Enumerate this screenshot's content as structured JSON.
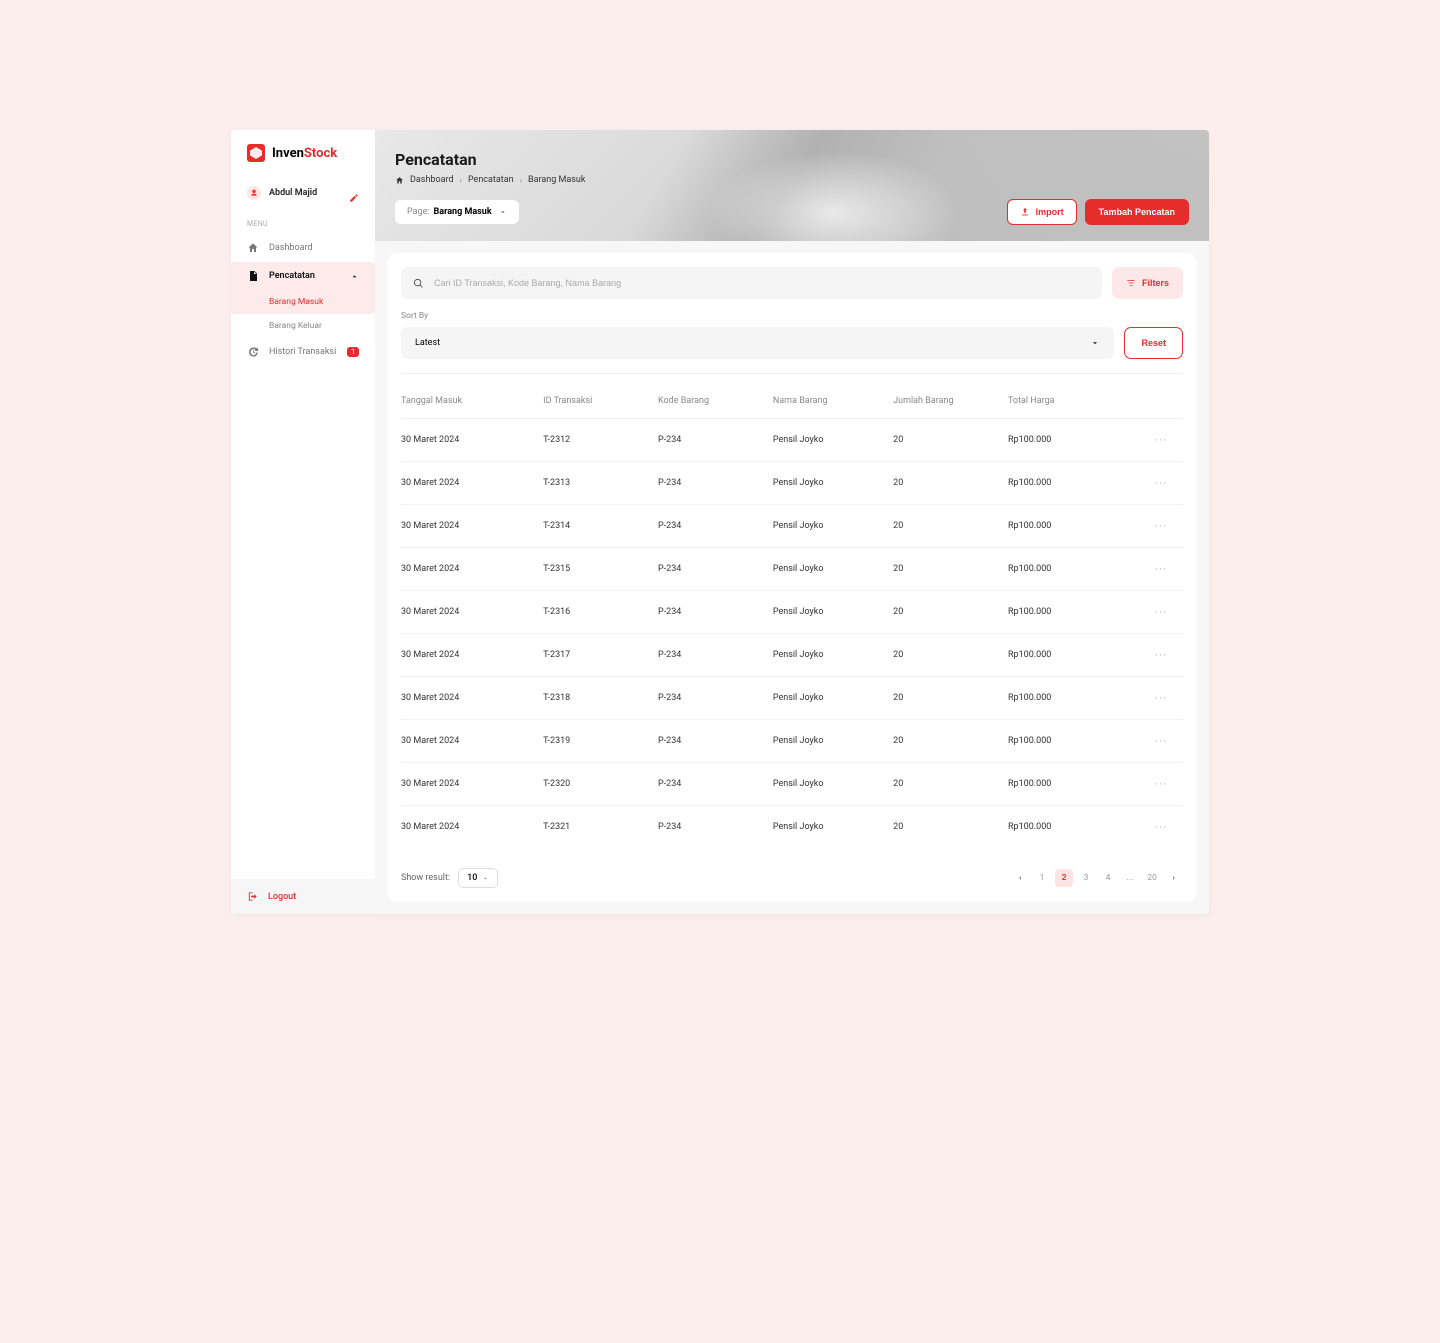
{
  "brand": {
    "name1": "Inven",
    "name2": "Stock"
  },
  "user": {
    "name": "Abdul Majid"
  },
  "menu": {
    "label": "MENU",
    "items": {
      "dashboard": "Dashboard",
      "pencatatan": "Pencatatan",
      "barang_masuk": "Barang Masuk",
      "barang_keluar": "Barang Keluar",
      "histori": "Histori Transaksi",
      "histori_badge": "1"
    }
  },
  "logout": "Logout",
  "header": {
    "title": "Pencatatan",
    "crumbs": [
      "Dashboard",
      "Pencatatan",
      "Barang Masuk"
    ],
    "page_label": "Page: ",
    "page_value": "Barang Masuk",
    "import": "Import",
    "add": "Tambah Pencatan"
  },
  "search": {
    "placeholder": "Cari ID Transaksi, Kode Barang, Nama Barang"
  },
  "filters_btn": "Filters",
  "sort": {
    "label": "Sort By",
    "value": "Latest",
    "reset": "Reset"
  },
  "columns": [
    "Tanggal Masuk",
    "ID Transaksi",
    "Kode Barang",
    "Nama Barang",
    "Jumlah Barang",
    "Total Harga"
  ],
  "rows": [
    {
      "tgl": "30 Maret 2024",
      "id": "T-2312",
      "kode": "P-234",
      "nama": "Pensil Joyko",
      "jml": "20",
      "total": "Rp100.000"
    },
    {
      "tgl": "30 Maret 2024",
      "id": "T-2313",
      "kode": "P-234",
      "nama": "Pensil Joyko",
      "jml": "20",
      "total": "Rp100.000"
    },
    {
      "tgl": "30 Maret 2024",
      "id": "T-2314",
      "kode": "P-234",
      "nama": "Pensil Joyko",
      "jml": "20",
      "total": "Rp100.000"
    },
    {
      "tgl": "30 Maret 2024",
      "id": "T-2315",
      "kode": "P-234",
      "nama": "Pensil Joyko",
      "jml": "20",
      "total": "Rp100.000"
    },
    {
      "tgl": "30 Maret 2024",
      "id": "T-2316",
      "kode": "P-234",
      "nama": "Pensil Joyko",
      "jml": "20",
      "total": "Rp100.000"
    },
    {
      "tgl": "30 Maret 2024",
      "id": "T-2317",
      "kode": "P-234",
      "nama": "Pensil Joyko",
      "jml": "20",
      "total": "Rp100.000"
    },
    {
      "tgl": "30 Maret 2024",
      "id": "T-2318",
      "kode": "P-234",
      "nama": "Pensil Joyko",
      "jml": "20",
      "total": "Rp100.000"
    },
    {
      "tgl": "30 Maret 2024",
      "id": "T-2319",
      "kode": "P-234",
      "nama": "Pensil Joyko",
      "jml": "20",
      "total": "Rp100.000"
    },
    {
      "tgl": "30 Maret 2024",
      "id": "T-2320",
      "kode": "P-234",
      "nama": "Pensil Joyko",
      "jml": "20",
      "total": "Rp100.000"
    },
    {
      "tgl": "30 Maret 2024",
      "id": "T-2321",
      "kode": "P-234",
      "nama": "Pensil Joyko",
      "jml": "20",
      "total": "Rp100.000"
    }
  ],
  "pagination": {
    "show_label": "Show result:",
    "show_value": "10",
    "pages": [
      "1",
      "2",
      "3",
      "4",
      "...",
      "20"
    ],
    "active": "2"
  }
}
